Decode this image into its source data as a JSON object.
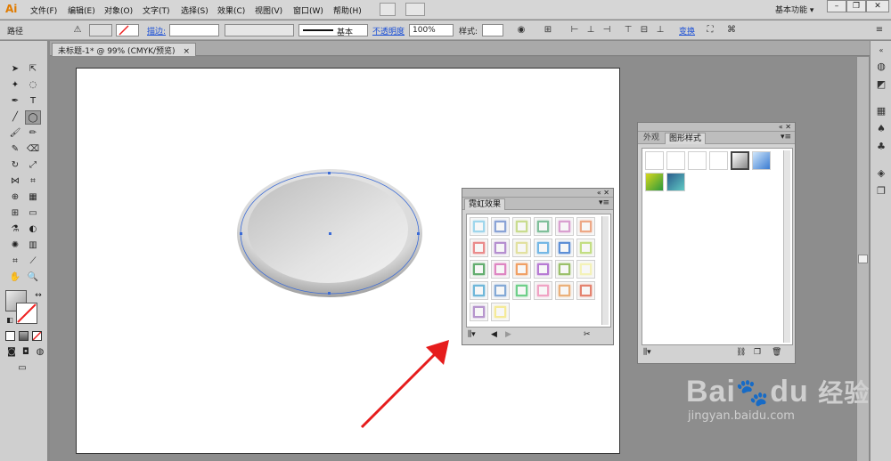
{
  "app": {
    "logo": "Ai"
  },
  "menubar": {
    "items": [
      "文件(F)",
      "编辑(E)",
      "对象(O)",
      "文字(T)",
      "选择(S)",
      "效果(C)",
      "视图(V)",
      "窗口(W)",
      "帮助(H)"
    ],
    "workspace": "基本功能"
  },
  "controlbar": {
    "object_type": "路径",
    "stroke_label": "描边:",
    "stroke_style": "基本",
    "opacity_label": "不透明度",
    "opacity_value": "100%",
    "style_label": "样式:",
    "transform_label": "变换"
  },
  "document": {
    "tab_title": "未标题-1* @ 99% (CMYK/预览)",
    "close": "×"
  },
  "panels": {
    "neon": {
      "tab": "霓虹效果",
      "swatch_colors": [
        "#9fd6ec",
        "#8aa3d6",
        "#c9dc8f",
        "#7fbf9a",
        "#d9a0d0",
        "#eda886",
        "#ea8b8b",
        "#b58fd0",
        "#e2e1a0",
        "#74b7e5",
        "#5d8fd6",
        "#c3de83",
        "#63ad6f",
        "#de86c2",
        "#f0a065",
        "#b77ad3",
        "#9bc06a",
        "#f4f2b8",
        "#6fb7d9",
        "#84a9d6",
        "#6fcf8a",
        "#f0a3c4",
        "#ebb07a",
        "#e4836f",
        "#b695cd",
        "#f5ea98"
      ]
    },
    "graphic_styles": {
      "tabs": [
        "外观",
        "图形样式"
      ],
      "active_tab": "图形样式"
    }
  },
  "watermark": {
    "brand": "Bai",
    "brand2": "du",
    "cn": "经验",
    "url": "jingyan.baidu.com"
  }
}
